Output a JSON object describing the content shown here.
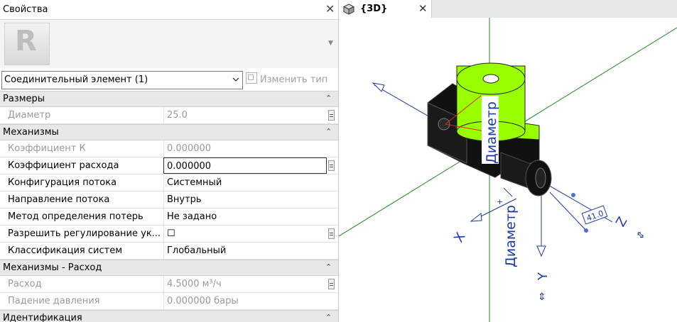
{
  "properties": {
    "title": "Свойства",
    "close_label": "✕",
    "type_selector": "Соединительный элемент (1)",
    "edit_type_label": "Изменить тип",
    "groups": [
      {
        "name": "Размеры",
        "rows": [
          {
            "label": "Диаметр",
            "value": "25.0",
            "disabled": true,
            "button": true
          }
        ]
      },
      {
        "name": "Механизмы",
        "rows": [
          {
            "label": "Коэффициент К",
            "value": "0.000000",
            "disabled": true
          },
          {
            "label": "Коэффициент расхода",
            "value": "0.000000",
            "focused": true,
            "button": true
          },
          {
            "label": "Конфигурация потока",
            "value": "Системный"
          },
          {
            "label": "Направление потока",
            "value": "Внутрь"
          },
          {
            "label": "Метод определения потерь",
            "value": "Не задано"
          },
          {
            "label": "Разрешить регулирование ук...",
            "value": "☐",
            "button": true
          },
          {
            "label": "Классификация систем",
            "value": "Глобальный"
          }
        ]
      },
      {
        "name": "Механизмы - Расход",
        "rows": [
          {
            "label": "Расход",
            "value": "4.5000 м³/ч",
            "disabled": true,
            "button": true
          },
          {
            "label": "Падение давления",
            "value": "0.000000 бары",
            "disabled": true
          }
        ]
      },
      {
        "name": "Идентификация",
        "rows": []
      }
    ]
  },
  "view": {
    "tab_label": "{3D}",
    "tab_close": "✕",
    "annotations": {
      "diameter_top": "Диаметр",
      "diameter_bottom": "Диаметр",
      "dim_value": "41.0",
      "axis_x": "X",
      "axis_y": "Y",
      "axis_z": "Z",
      "flip_1": "⇕",
      "flip_2": "⇕"
    },
    "colors": {
      "accent_green": "#99ff00",
      "axis_blue": "#1a3aa8",
      "grid_green": "#1f8a1f",
      "body_black": "#111111"
    }
  }
}
